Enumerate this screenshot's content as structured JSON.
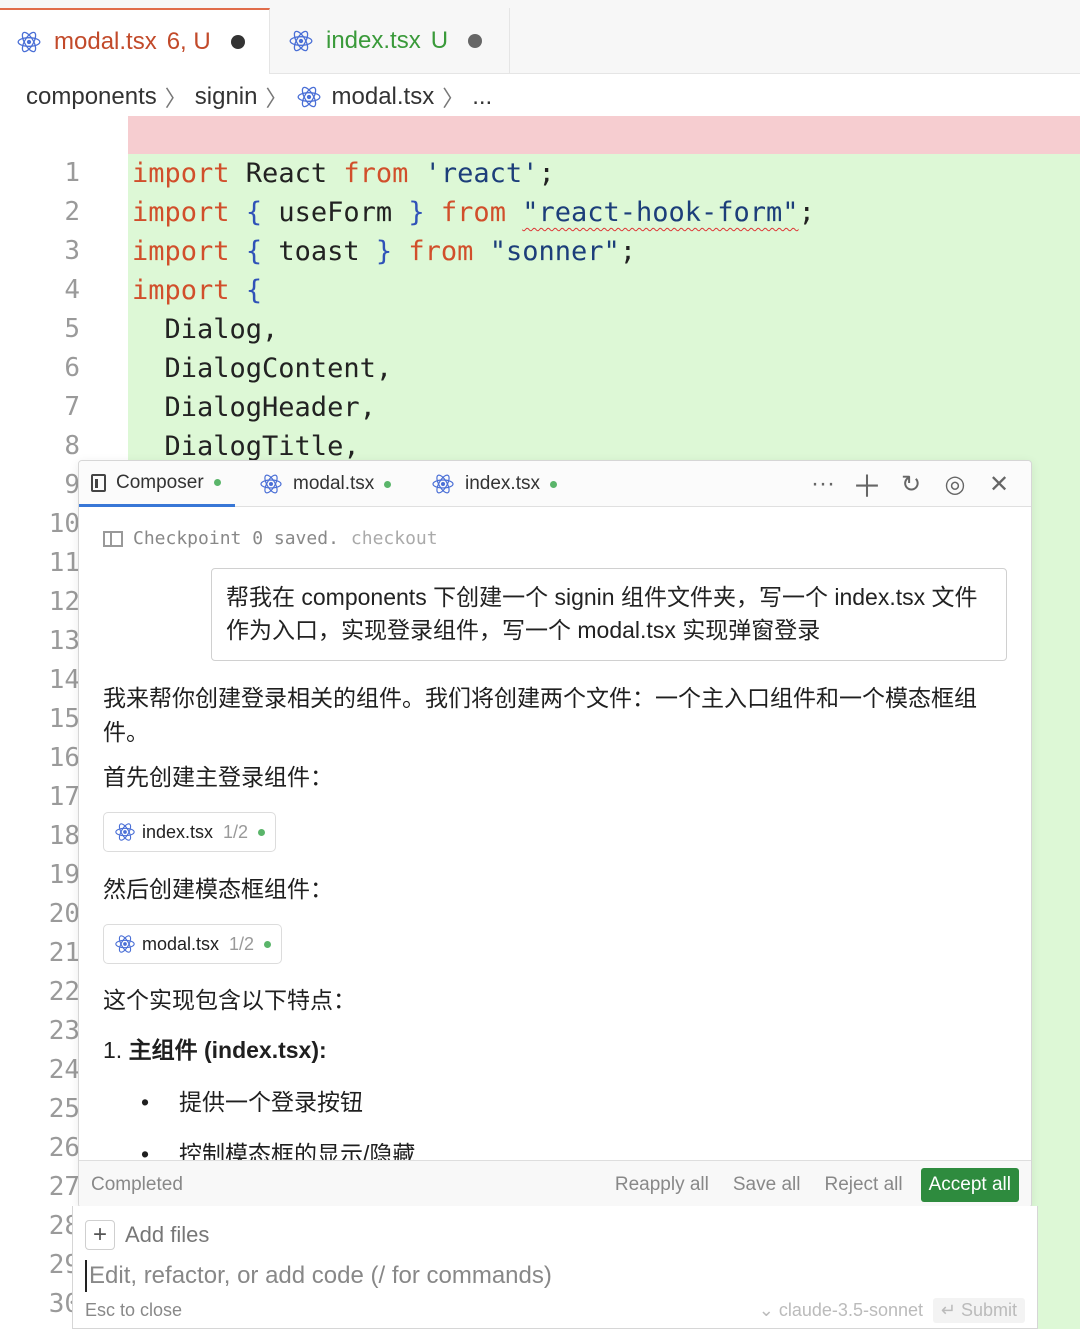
{
  "colors": {
    "accent_tab": "#e06c4a",
    "accept_button": "#2e8b3e",
    "added_line_bg": "#ddf8d6",
    "deleted_line_bg": "#f6cdd0",
    "react_icon": "#4a6fd6"
  },
  "tabs": [
    {
      "name": "modal.tsx",
      "badge": "6, U",
      "icon": "react-icon",
      "modified": true
    },
    {
      "name": "index.tsx",
      "badge": "U",
      "icon": "react-icon",
      "modified": true
    }
  ],
  "breadcrumb": {
    "parts": [
      "components",
      "signin",
      "modal.tsx",
      "..."
    ]
  },
  "editor": {
    "line_numbers": [
      "1",
      "2",
      "3",
      "4",
      "5",
      "6",
      "7",
      "8",
      "9",
      "10",
      "11",
      "12",
      "13",
      "14",
      "15",
      "16",
      "17",
      "18",
      "19",
      "20",
      "21",
      "22",
      "23",
      "24",
      "25",
      "26",
      "27",
      "28",
      "29",
      "30"
    ],
    "lines": [
      [
        {
          "t": "import",
          "c": "kw"
        },
        {
          "t": " React ",
          "c": ""
        },
        {
          "t": "from",
          "c": "kw"
        },
        {
          "t": " ",
          "c": ""
        },
        {
          "t": "'react'",
          "c": "str"
        },
        {
          "t": ";",
          "c": ""
        }
      ],
      [
        {
          "t": "import",
          "c": "kw"
        },
        {
          "t": " ",
          "c": ""
        },
        {
          "t": "{",
          "c": "brace"
        },
        {
          "t": " useForm ",
          "c": ""
        },
        {
          "t": "}",
          "c": "brace"
        },
        {
          "t": " ",
          "c": ""
        },
        {
          "t": "from",
          "c": "kw"
        },
        {
          "t": " ",
          "c": ""
        },
        {
          "t": "\"react-hook-form\"",
          "c": "str squig"
        },
        {
          "t": ";",
          "c": ""
        }
      ],
      [
        {
          "t": "import",
          "c": "kw"
        },
        {
          "t": " ",
          "c": ""
        },
        {
          "t": "{",
          "c": "brace"
        },
        {
          "t": " toast ",
          "c": ""
        },
        {
          "t": "}",
          "c": "brace"
        },
        {
          "t": " ",
          "c": ""
        },
        {
          "t": "from",
          "c": "kw"
        },
        {
          "t": " ",
          "c": ""
        },
        {
          "t": "\"sonner\"",
          "c": "str"
        },
        {
          "t": ";",
          "c": ""
        }
      ],
      [
        {
          "t": "import",
          "c": "kw"
        },
        {
          "t": " ",
          "c": ""
        },
        {
          "t": "{",
          "c": "brace"
        }
      ],
      [
        {
          "t": "  Dialog,",
          "c": ""
        }
      ],
      [
        {
          "t": "  DialogContent,",
          "c": ""
        }
      ],
      [
        {
          "t": "  DialogHeader,",
          "c": ""
        }
      ],
      [
        {
          "t": "  DialogTitle,",
          "c": ""
        }
      ]
    ]
  },
  "composer": {
    "tabs": [
      {
        "label": "Composer",
        "icon": "document-icon"
      },
      {
        "label": "modal.tsx",
        "icon": "react-icon"
      },
      {
        "label": "index.tsx",
        "icon": "react-icon"
      }
    ],
    "tools": [
      "more-icon",
      "plus-icon",
      "history-icon",
      "gauge-icon",
      "close-icon"
    ],
    "checkpoint": {
      "text": "Checkpoint 0 saved.",
      "link": "checkout"
    },
    "user_message": "帮我在 components 下创建一个 signin 组件文件夹，写一个 index.tsx 文件作为入口，实现登录组件，写一个 modal.tsx 实现弹窗登录",
    "assistant": {
      "intro": "我来帮你创建登录相关的组件。我们将创建两个文件：一个主入口组件和一个模态框组件。",
      "step1": "首先创建主登录组件：",
      "file1": {
        "name": "index.tsx",
        "progress": "1/2"
      },
      "step2": "然后创建模态框组件：",
      "file2": {
        "name": "modal.tsx",
        "progress": "1/2"
      },
      "features": "这个实现包含以下特点：",
      "list_num": "1.",
      "list_heading": "主组件 (index.tsx):",
      "bullets": [
        "提供一个登录按钮",
        "控制模态框的显示/隐藏"
      ]
    },
    "status": "Completed",
    "actions": {
      "reapply": "Reapply all",
      "save": "Save all",
      "reject": "Reject all",
      "accept": "Accept all"
    }
  },
  "input": {
    "add_files": "Add files",
    "placeholder": "Edit, refactor, or add code (/ for commands)",
    "esc_hint": "Esc to close",
    "model": "claude-3.5-sonnet",
    "submit": "Submit"
  }
}
